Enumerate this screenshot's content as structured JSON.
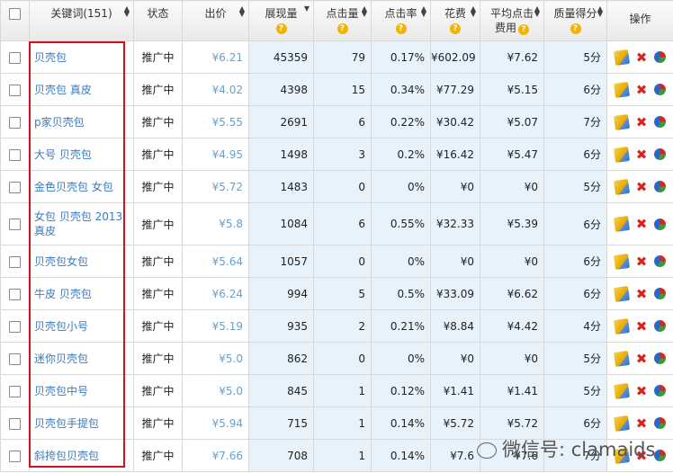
{
  "header": {
    "keyword": "关键词(151)",
    "status": "状态",
    "bid": "出价",
    "impressions": "展现量",
    "clicks": "点击量",
    "ctr": "点击率",
    "cost": "花费",
    "avg_cpc_1": "平均点击",
    "avg_cpc_2": "费用",
    "quality": "质量得分",
    "ops": "操作"
  },
  "rows": [
    {
      "keyword": "贝壳包",
      "status": "推广中",
      "bid": "¥6.21",
      "impressions": "45359",
      "clicks": "79",
      "ctr": "0.17%",
      "cost": "¥602.09",
      "cpc": "¥7.62",
      "quality": "5分"
    },
    {
      "keyword": "贝壳包 真皮",
      "status": "推广中",
      "bid": "¥4.02",
      "impressions": "4398",
      "clicks": "15",
      "ctr": "0.34%",
      "cost": "¥77.29",
      "cpc": "¥5.15",
      "quality": "6分"
    },
    {
      "keyword": "p家贝壳包",
      "status": "推广中",
      "bid": "¥5.55",
      "impressions": "2691",
      "clicks": "6",
      "ctr": "0.22%",
      "cost": "¥30.42",
      "cpc": "¥5.07",
      "quality": "7分"
    },
    {
      "keyword": "大号 贝壳包",
      "status": "推广中",
      "bid": "¥4.95",
      "impressions": "1498",
      "clicks": "3",
      "ctr": "0.2%",
      "cost": "¥16.42",
      "cpc": "¥5.47",
      "quality": "6分"
    },
    {
      "keyword": "金色贝壳包 女包",
      "status": "推广中",
      "bid": "¥5.72",
      "impressions": "1483",
      "clicks": "0",
      "ctr": "0%",
      "cost": "¥0",
      "cpc": "¥0",
      "quality": "5分"
    },
    {
      "keyword": "女包 贝壳包 2013 真皮",
      "status": "推广中",
      "bid": "¥5.8",
      "impressions": "1084",
      "clicks": "6",
      "ctr": "0.55%",
      "cost": "¥32.33",
      "cpc": "¥5.39",
      "quality": "6分"
    },
    {
      "keyword": "贝壳包女包",
      "status": "推广中",
      "bid": "¥5.64",
      "impressions": "1057",
      "clicks": "0",
      "ctr": "0%",
      "cost": "¥0",
      "cpc": "¥0",
      "quality": "6分"
    },
    {
      "keyword": "牛皮 贝壳包",
      "status": "推广中",
      "bid": "¥6.24",
      "impressions": "994",
      "clicks": "5",
      "ctr": "0.5%",
      "cost": "¥33.09",
      "cpc": "¥6.62",
      "quality": "6分"
    },
    {
      "keyword": "贝壳包小号",
      "status": "推广中",
      "bid": "¥5.19",
      "impressions": "935",
      "clicks": "2",
      "ctr": "0.21%",
      "cost": "¥8.84",
      "cpc": "¥4.42",
      "quality": "4分"
    },
    {
      "keyword": "迷你贝壳包",
      "status": "推广中",
      "bid": "¥5.0",
      "impressions": "862",
      "clicks": "0",
      "ctr": "0%",
      "cost": "¥0",
      "cpc": "¥0",
      "quality": "5分"
    },
    {
      "keyword": "贝壳包中号",
      "status": "推广中",
      "bid": "¥5.0",
      "impressions": "845",
      "clicks": "1",
      "ctr": "0.12%",
      "cost": "¥1.41",
      "cpc": "¥1.41",
      "quality": "5分"
    },
    {
      "keyword": "贝壳包手提包",
      "status": "推广中",
      "bid": "¥5.94",
      "impressions": "715",
      "clicks": "1",
      "ctr": "0.14%",
      "cost": "¥5.72",
      "cpc": "¥5.72",
      "quality": "6分"
    },
    {
      "keyword": "斜挎包贝壳包",
      "status": "推广中",
      "bid": "¥7.66",
      "impressions": "708",
      "clicks": "1",
      "ctr": "0.14%",
      "cost": "¥7.6",
      "cpc": "¥7.6",
      "quality": "7分"
    }
  ],
  "watermark": "微信号: clamaids",
  "colors": {
    "highlight_border": "#d40f1e",
    "link": "#3a7bbf",
    "stat_bg": "#e8f2fb"
  },
  "icons": {
    "edit": "edit-icon",
    "delete": "delete-icon",
    "report": "pie-chart-icon",
    "help": "help-icon"
  }
}
